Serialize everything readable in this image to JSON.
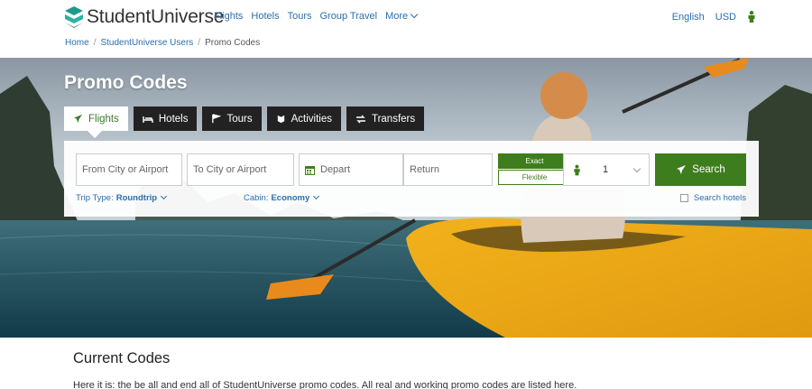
{
  "header": {
    "logo_text": "StudentUniverse",
    "nav": {
      "flights": "Flights",
      "hotels": "Hotels",
      "tours": "Tours",
      "group_travel": "Group Travel",
      "more": "More"
    },
    "language": "English",
    "currency": "USD",
    "brand_color": "#1f9a8a"
  },
  "breadcrumb": {
    "home": "Home",
    "users": "StudentUniverse Users",
    "current": "Promo Codes"
  },
  "hero": {
    "title": "Promo Codes",
    "tabs": {
      "flights": "Flights",
      "hotels": "Hotels",
      "tours": "Tours",
      "activities": "Activities",
      "transfers": "Transfers"
    }
  },
  "search": {
    "from_placeholder": "From City or Airport",
    "to_placeholder": "To City or Airport",
    "depart_placeholder": "Depart",
    "return_placeholder": "Return",
    "exact_label": "Exact",
    "flexible_label": "Flexible",
    "travelers_count": "1",
    "search_label": "Search",
    "trip_type_label": "Trip Type:",
    "trip_type_value": "Roundtrip",
    "cabin_label": "Cabin:",
    "cabin_value": "Economy",
    "search_hotels_label": "Search hotels",
    "accent_color": "#3e7d1d"
  },
  "content": {
    "title": "Current Codes",
    "text": "Here it is: the be all and end all of StudentUniverse promo codes. All real and working promo codes are listed here."
  }
}
